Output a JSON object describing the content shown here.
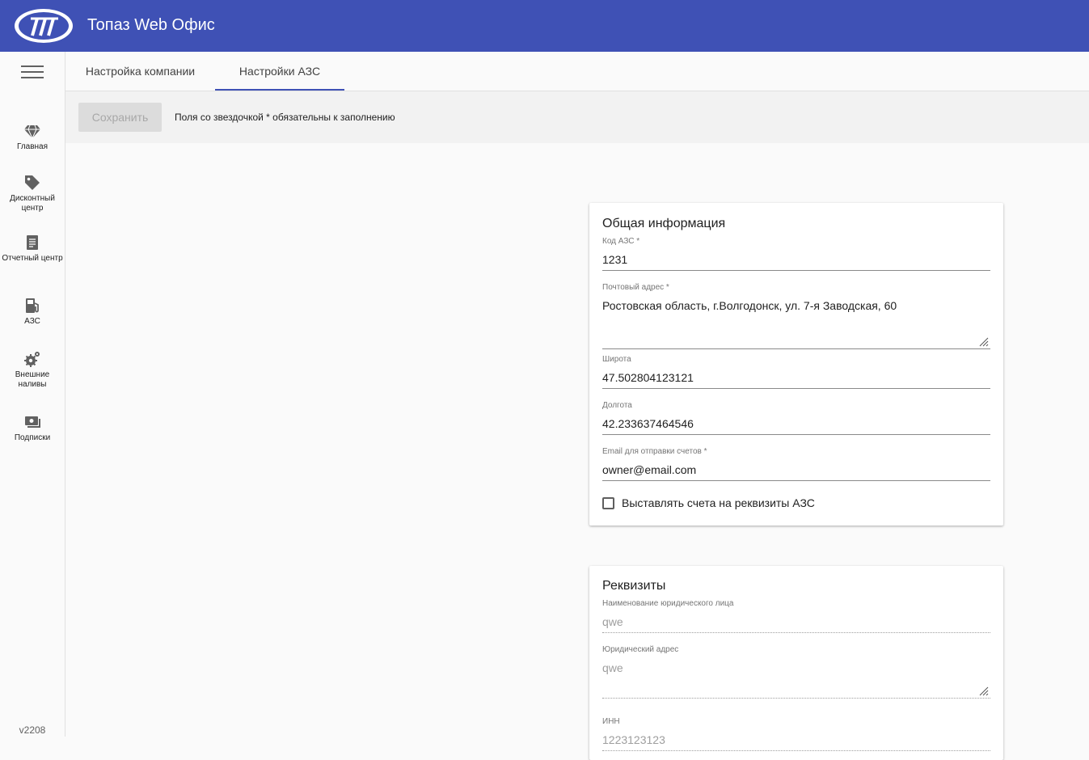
{
  "app": {
    "title": "Топаз Web Офис",
    "version": "v2208"
  },
  "sidebar": {
    "items": [
      {
        "label": "Главная",
        "icon": "diamond-icon"
      },
      {
        "label": "Дисконтный центр",
        "icon": "tag-icon"
      },
      {
        "label": "Отчетный центр",
        "icon": "report-icon"
      },
      {
        "label": "АЗС",
        "icon": "fuel-station-icon"
      },
      {
        "label": "Внешние наливы",
        "icon": "gears-icon"
      },
      {
        "label": "Подписки",
        "icon": "subscription-icon"
      }
    ]
  },
  "tabs": [
    {
      "label": "Настройка компании",
      "active": false
    },
    {
      "label": "Настройки АЗС",
      "active": true
    }
  ],
  "toolbar": {
    "save_label": "Сохранить",
    "required_note": "Поля со звездочкой * обязательны к заполнению"
  },
  "general": {
    "title": "Общая информация",
    "station_code": {
      "label": "Код АЗС *",
      "value": "1231"
    },
    "postal_address": {
      "label": "Почтовый адрес *",
      "value": "Ростовская область, г.Волгодонск, ул. 7-я Заводская, 60"
    },
    "latitude": {
      "label": "Широта",
      "value": "47.502804123121"
    },
    "longitude": {
      "label": "Долгота",
      "value": "42.233637464546"
    },
    "email": {
      "label": "Email для отправки счетов *",
      "value": "owner@email.com"
    },
    "invoice_checkbox": {
      "label": "Выставлять счета на реквизиты АЗС",
      "checked": false
    }
  },
  "requisites": {
    "title": "Реквизиты",
    "legal_name": {
      "label": "Наименование юридического лица",
      "value": "qwe"
    },
    "legal_address": {
      "label": "Юридический адрес",
      "value": "qwe"
    },
    "inn": {
      "label": "ИНН",
      "value": "1223123123"
    }
  },
  "colors": {
    "header": "#3f51b5",
    "accent": "#3f51b5"
  }
}
